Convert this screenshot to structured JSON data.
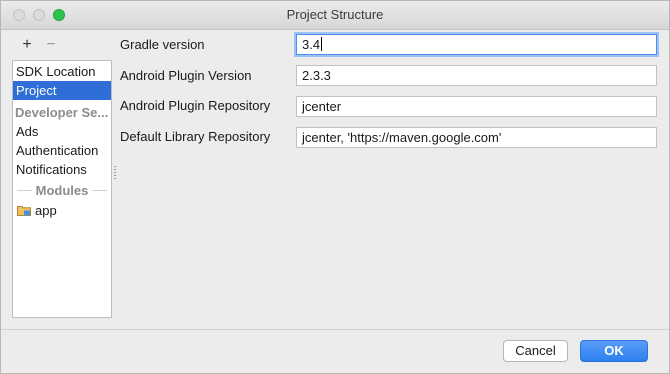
{
  "window": {
    "title": "Project Structure"
  },
  "toolbar": {
    "add_label": "+",
    "remove_label": "−"
  },
  "sidebar": {
    "items": [
      {
        "label": "SDK Location"
      },
      {
        "label": "Project"
      },
      {
        "label": "Developer Se..."
      },
      {
        "label": "Ads"
      },
      {
        "label": "Authentication"
      },
      {
        "label": "Notifications"
      }
    ],
    "modules_header": "Modules",
    "modules": [
      {
        "label": "app",
        "icon": "module-folder-icon"
      }
    ],
    "selected": "Project"
  },
  "form": {
    "rows": [
      {
        "label": "Gradle version",
        "value": "3.4"
      },
      {
        "label": "Android Plugin Version",
        "value": "2.3.3"
      },
      {
        "label": "Android Plugin Repository",
        "value": "jcenter"
      },
      {
        "label": "Default Library Repository",
        "value": "jcenter, 'https://maven.google.com'"
      }
    ]
  },
  "buttons": {
    "cancel": "Cancel",
    "ok": "OK"
  },
  "colors": {
    "accent": "#2f6ed6",
    "ok_button": "#2d7ff0",
    "focus_ring": "#9cc1f6"
  }
}
